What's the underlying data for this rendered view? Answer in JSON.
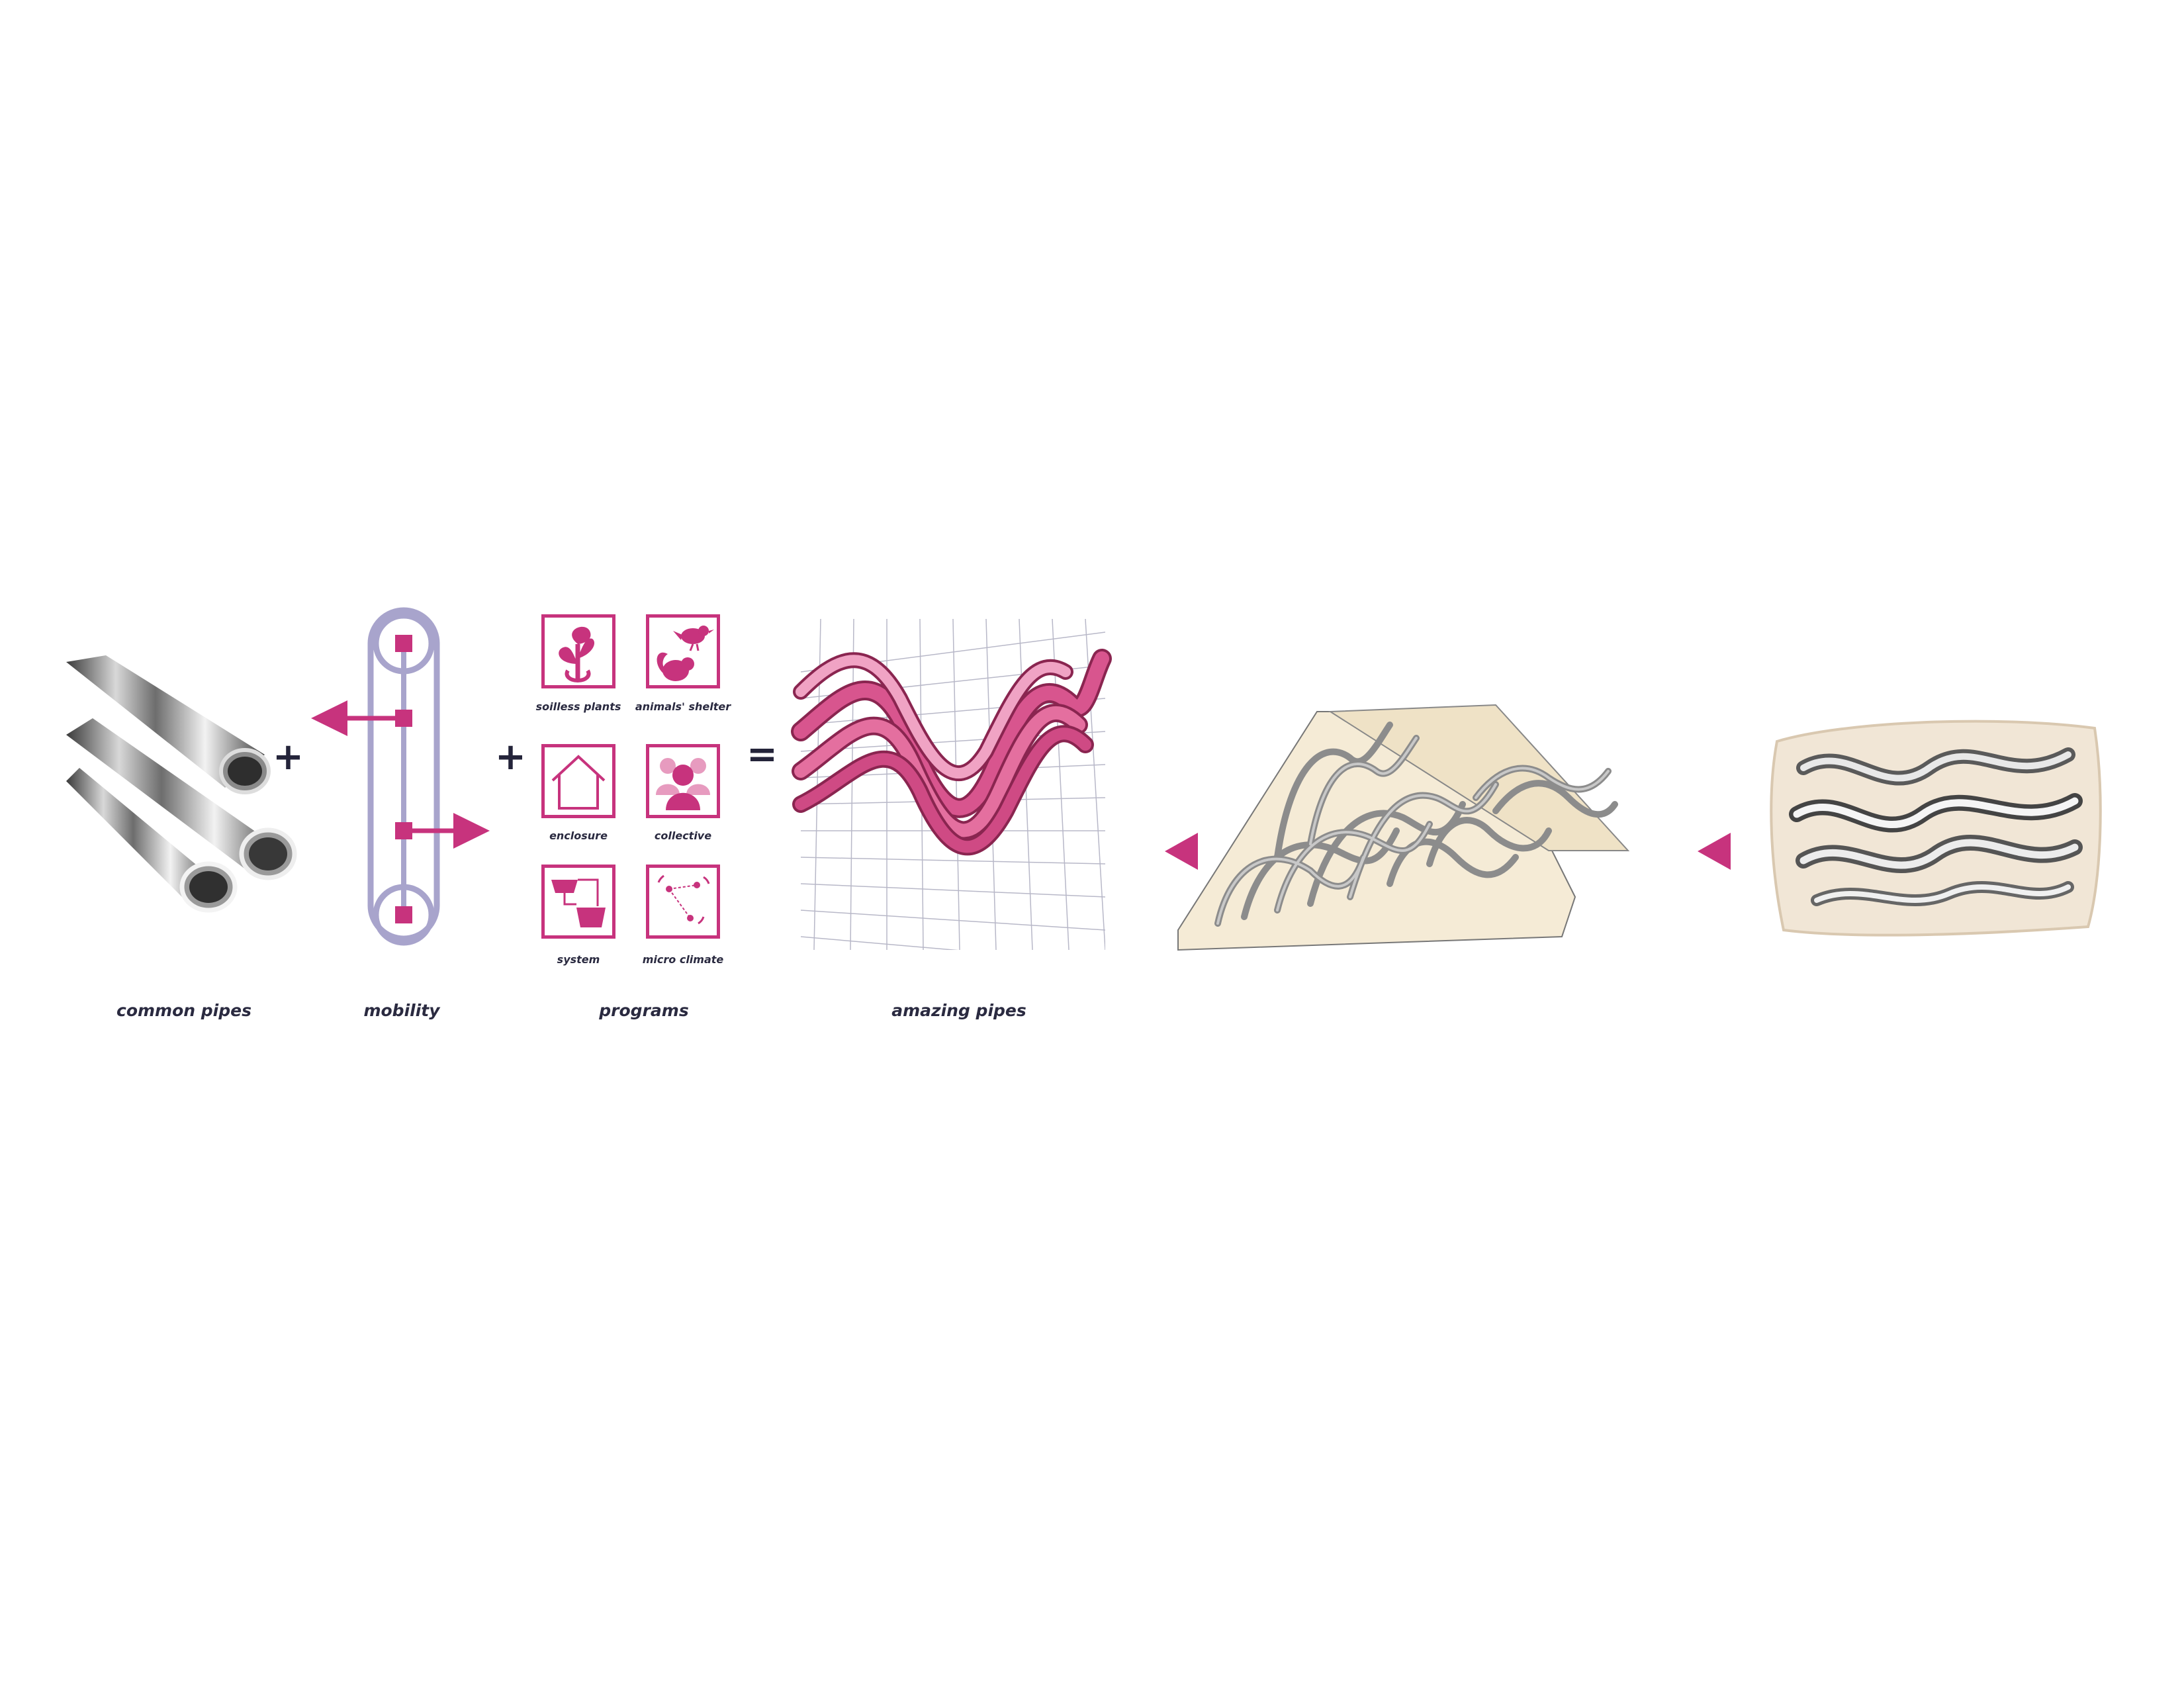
{
  "operators": {
    "plus1": "+",
    "plus2": "+",
    "equals": "="
  },
  "captions": {
    "common_pipes": "common pipes",
    "mobility": "mobility",
    "programs": "programs",
    "amazing_pipes": "amazing pipes"
  },
  "programs": [
    {
      "label": "soilless plants",
      "icon": "plant-icon"
    },
    {
      "label": "animals' shelter",
      "icon": "bird-squirrel-icon"
    },
    {
      "label": "enclosure",
      "icon": "house-icon"
    },
    {
      "label": "collective",
      "icon": "people-icon"
    },
    {
      "label": "system",
      "icon": "system-icon"
    },
    {
      "label": "micro climate",
      "icon": "signal-icon"
    }
  ],
  "colors": {
    "accent": "#c7337d",
    "mobility_frame": "#a8a4cc",
    "text": "#2a2a40"
  }
}
